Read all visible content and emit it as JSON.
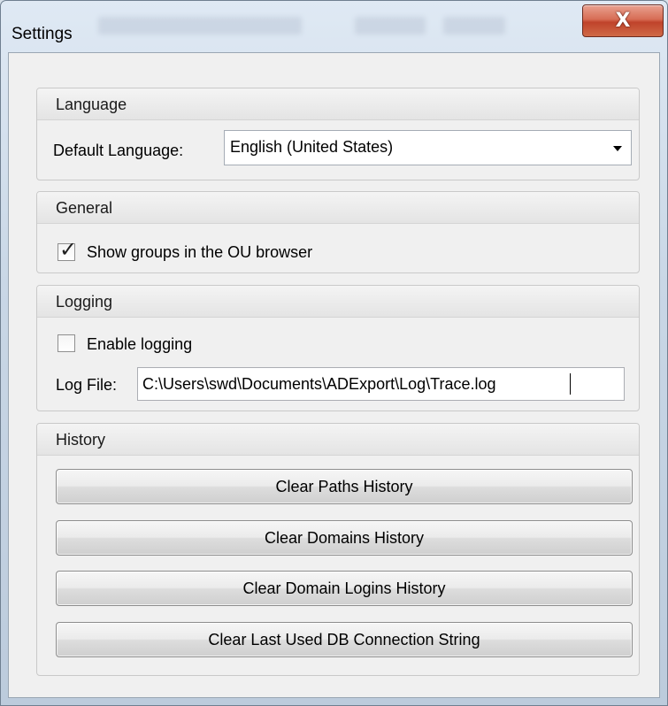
{
  "window": {
    "title": "Settings",
    "close_glyph": "X"
  },
  "language": {
    "header": "Language",
    "default_language_label": "Default Language:",
    "default_language_value": "English (United States)"
  },
  "general": {
    "header": "General",
    "show_groups_label": "Show groups in the OU browser",
    "show_groups_checked": true
  },
  "logging": {
    "header": "Logging",
    "enable_logging_label": "Enable logging",
    "enable_logging_checked": false,
    "log_file_label": "Log File:",
    "log_file_value": "C:\\Users\\swd\\Documents\\ADExport\\Log\\Trace.log"
  },
  "history": {
    "header": "History",
    "buttons": [
      "Clear Paths History",
      "Clear Domains History",
      "Clear Domain Logins History",
      "Clear Last Used DB Connection String"
    ]
  },
  "icons": {
    "close": "close-icon",
    "dropdown": "chevron-down-icon",
    "check": "checkmark-icon"
  }
}
